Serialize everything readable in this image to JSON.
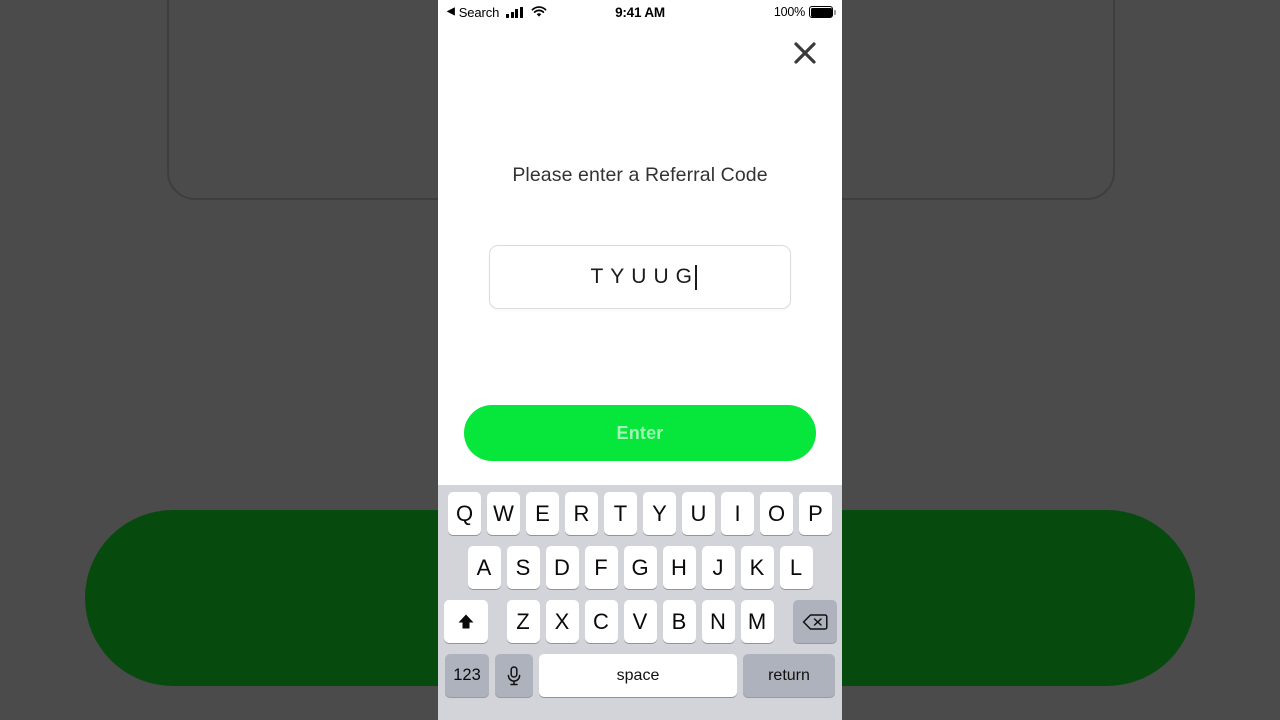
{
  "background": {
    "page_color": "#4b4b4b",
    "shape_rounded_rect_border": "#3e3e3e",
    "shape_pill_color": "#064a0e"
  },
  "status_bar": {
    "back_label": "Search",
    "back_arrow": "◀",
    "signal_icon": "cellular-signal-icon",
    "wifi_icon": "wifi-icon",
    "time": "9:41 AM",
    "battery_percent": "100%",
    "battery_icon": "battery-full-icon"
  },
  "modal": {
    "close_icon": "close-icon",
    "title": "Please enter a Referral Code",
    "input": {
      "value": "TYUUG",
      "placeholder": "",
      "caret_visible": true
    },
    "submit": {
      "label": "Enter",
      "color": "#06e63b",
      "text_color": "rgba(255,255,255,0.62)"
    }
  },
  "keyboard": {
    "background_color": "#d2d4da",
    "key_color": "#ffffff",
    "special_key_color": "#adb2bd",
    "row1": [
      "Q",
      "W",
      "E",
      "R",
      "T",
      "Y",
      "U",
      "I",
      "O",
      "P"
    ],
    "row2": [
      "A",
      "S",
      "D",
      "F",
      "G",
      "H",
      "J",
      "K",
      "L"
    ],
    "row3_letters": [
      "Z",
      "X",
      "C",
      "V",
      "B",
      "N",
      "M"
    ],
    "shift_key": {
      "name": "shift-key",
      "icon": "shift-arrow-up-icon",
      "active": true
    },
    "backspace_key": {
      "name": "backspace-key",
      "icon": "backspace-delete-icon"
    },
    "numbers_key": "123",
    "mic_key": {
      "name": "microphone-key",
      "icon": "microphone-icon"
    },
    "space_key": "space",
    "return_key": "return"
  }
}
